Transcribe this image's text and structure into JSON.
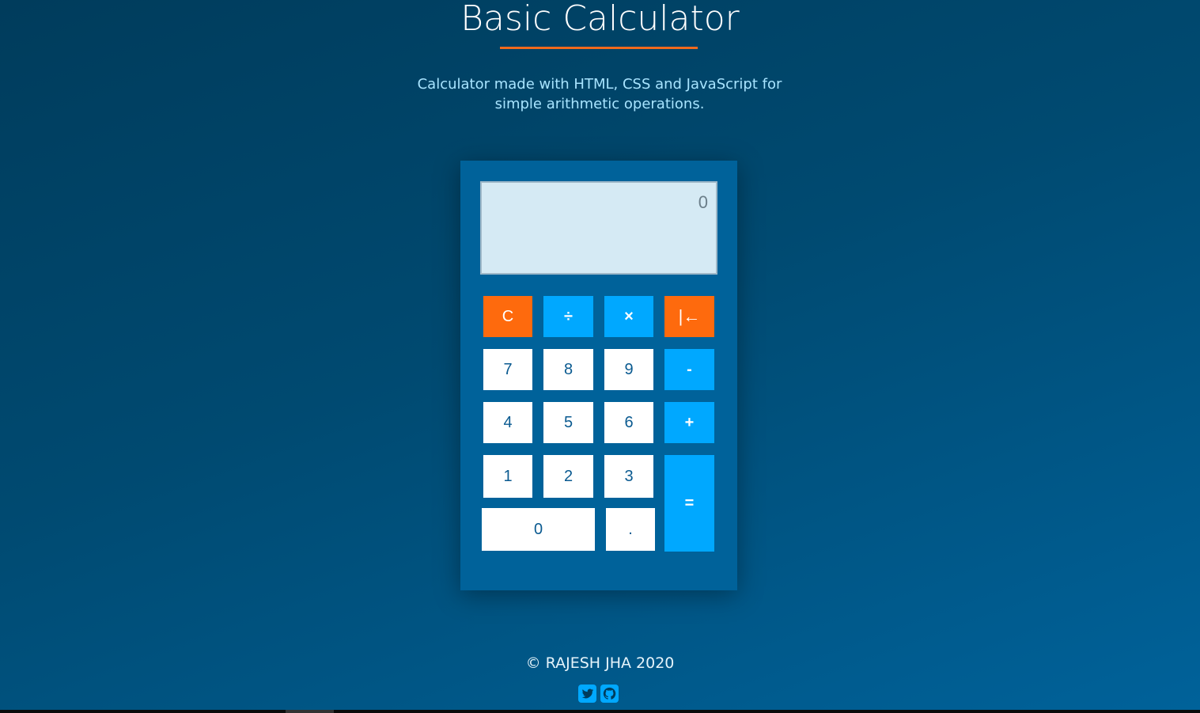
{
  "header": {
    "title": "Basic Calculator",
    "subtitle_line1": "Calculator made with HTML, CSS and JavaScript for",
    "subtitle_line2": "simple arithmetic operations."
  },
  "calculator": {
    "display_value": "0",
    "keys": {
      "clear": "C",
      "divide": "÷",
      "multiply": "×",
      "backspace": "|←",
      "seven": "7",
      "eight": "8",
      "nine": "9",
      "minus": "-",
      "four": "4",
      "five": "5",
      "six": "6",
      "plus": "+",
      "one": "1",
      "two": "2",
      "three": "3",
      "equals": "=",
      "zero": "0",
      "decimal": "."
    }
  },
  "footer": {
    "copyright": "© RAJESH JHA 2020",
    "icons": [
      "twitter-icon",
      "github-icon"
    ]
  },
  "colors": {
    "background_start": "#003c5c",
    "background_end": "#00629a",
    "calculator_body": "#00629a",
    "display": "#d5eaf4",
    "accent_orange": "#fe6a0d",
    "accent_blue": "#00a8ff",
    "title_underline": "#f06a1d"
  }
}
